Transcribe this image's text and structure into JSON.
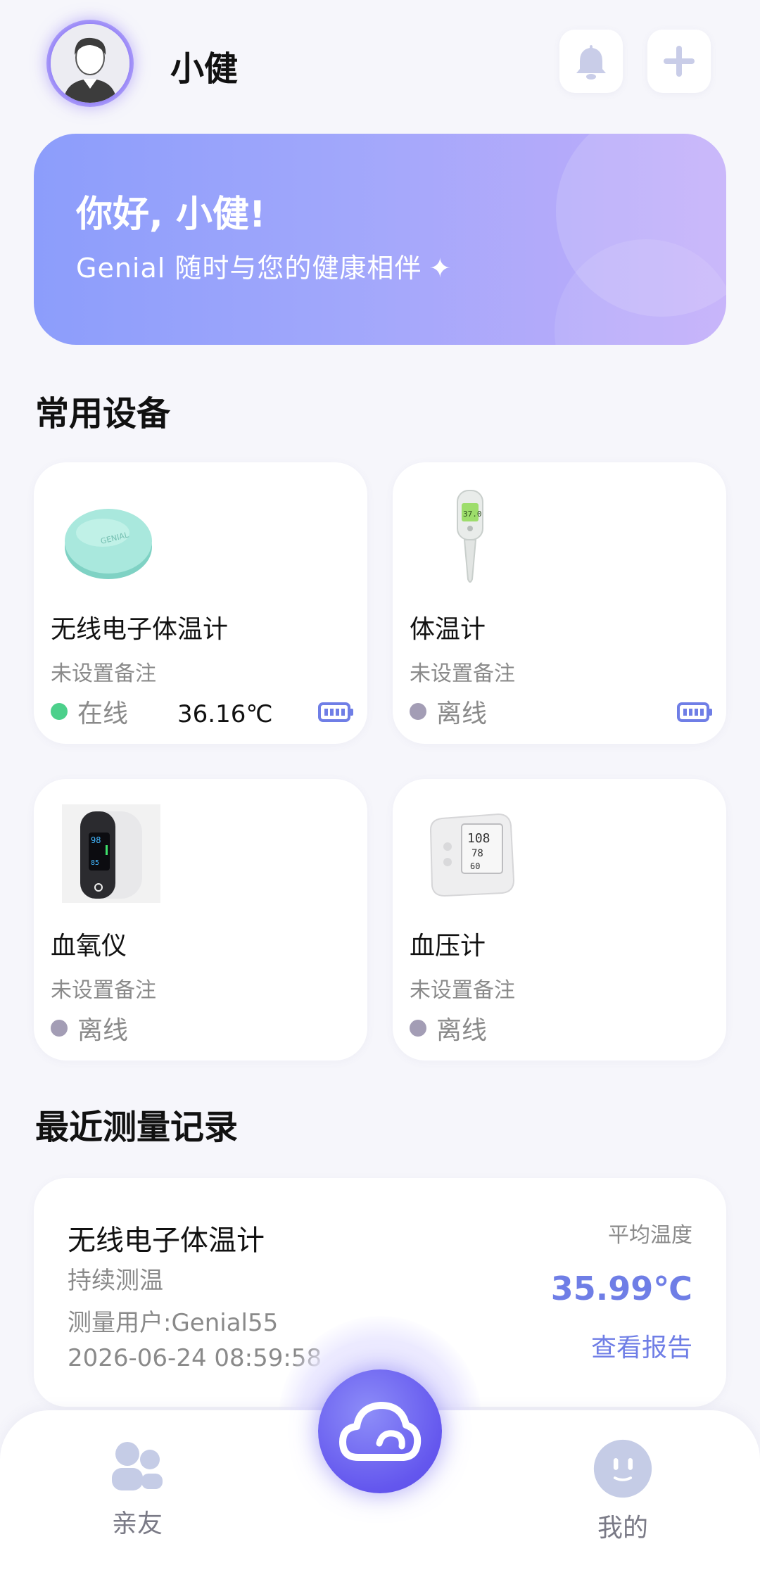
{
  "header": {
    "user_name": "小健"
  },
  "banner": {
    "greeting": "你好, 小健!",
    "subtitle": "Genial 随时与您的健康相伴",
    "sparkle": "✦"
  },
  "devices_section": {
    "title": "常用设备",
    "items": [
      {
        "name": "无线电子体温计",
        "note": "未设置备注",
        "status": "在线",
        "online": true,
        "temperature": "36.16℃",
        "battery": true,
        "icon": "temperature-patch-icon"
      },
      {
        "name": "体温计",
        "note": "未设置备注",
        "status": "离线",
        "online": false,
        "temperature": "",
        "battery": true,
        "icon": "digital-thermometer-icon"
      },
      {
        "name": "血氧仪",
        "note": "未设置备注",
        "status": "离线",
        "online": false,
        "temperature": "",
        "battery": false,
        "icon": "pulse-oximeter-icon"
      },
      {
        "name": "血压计",
        "note": "未设置备注",
        "status": "离线",
        "online": false,
        "temperature": "",
        "battery": false,
        "icon": "blood-pressure-monitor-icon"
      }
    ]
  },
  "records_section": {
    "title": "最近测量记录",
    "record": {
      "device_name": "无线电子体温计",
      "mode": "持续测温",
      "user": "测量用户:Genial55",
      "time": "2026-06-24 08:59:58",
      "avg_label": "平均温度",
      "avg_value": "35.99℃",
      "report_link": "查看报告"
    }
  },
  "bottom_nav": {
    "friends_label": "亲友",
    "mine_label": "我的"
  },
  "colors": {
    "accent": "#6f7ee6",
    "online": "#4cd08b",
    "offline": "#a39db5",
    "banner_start": "#8c9dfb",
    "banner_end": "#c2adfa",
    "center_button": "#6457ee"
  }
}
